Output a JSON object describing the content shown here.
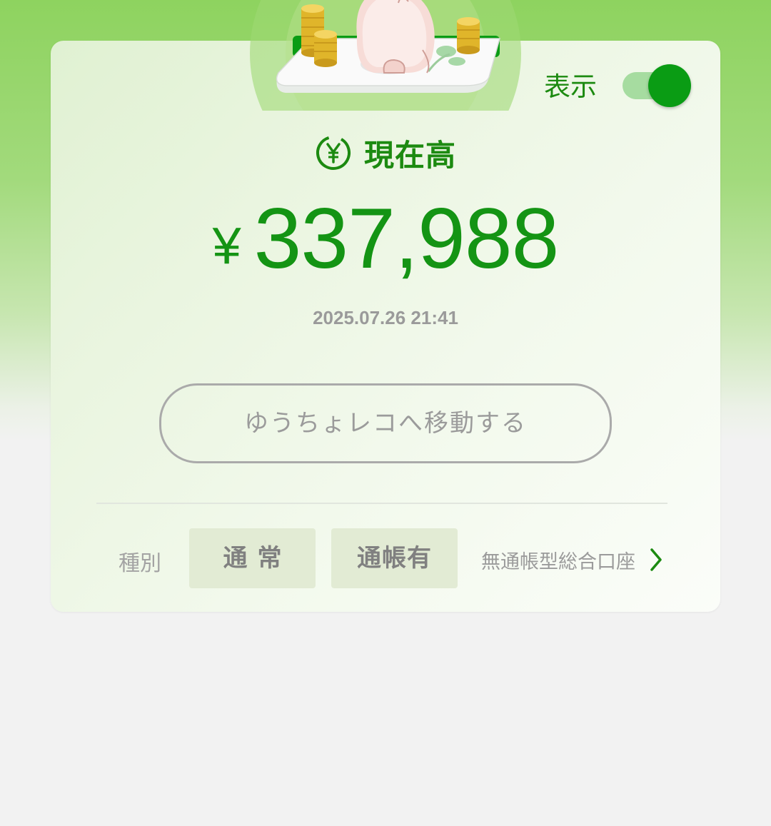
{
  "balance_card": {
    "toggle_label": "表示",
    "toggle_state": "on",
    "heading": "現在高",
    "currency_symbol": "¥",
    "amount": "337,988",
    "timestamp": "2025.07.26 21:41",
    "move_button_label": "ゆうちょレコへ移動する",
    "type_label": "種別",
    "chips": [
      "通常",
      "通帳有"
    ],
    "account_link": "無通帳型総合口座"
  },
  "colors": {
    "accent_green": "#149414",
    "toggle_on": "#0a9c14",
    "muted_text": "#9b9b9b"
  },
  "icons": {
    "heading": "yen-circle-icon",
    "account_link": "chevron-right-icon",
    "illustration": "cat-with-coins-illustration"
  }
}
